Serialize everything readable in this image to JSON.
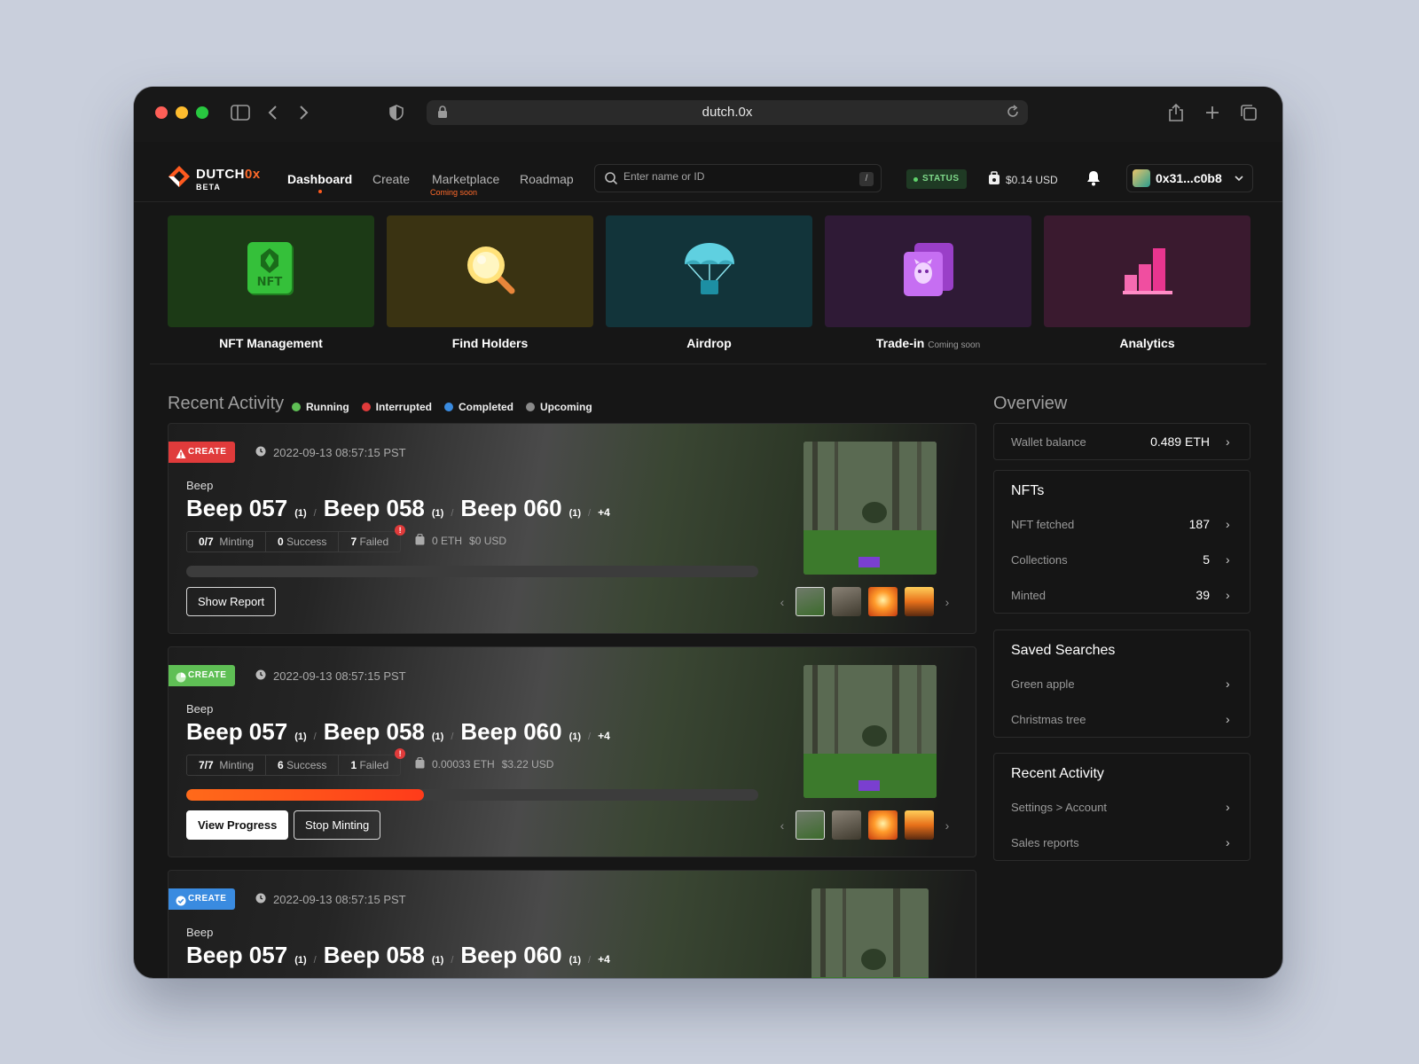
{
  "browser": {
    "url": "dutch.0x"
  },
  "logo": {
    "text": "DUTCH",
    "accent": "0x",
    "sub": "BETA"
  },
  "nav": [
    {
      "label": "Dashboard",
      "active": true
    },
    {
      "label": "Create"
    },
    {
      "label": "Marketplace",
      "note": "Coming soon"
    },
    {
      "label": "Roadmap"
    }
  ],
  "search": {
    "placeholder": "Enter name or ID",
    "shortcut": "/"
  },
  "status": "STATUS",
  "balance": "$0.14 USD",
  "account": "0x31...c0b8",
  "tiles": [
    {
      "label": "NFT Management",
      "color": "#1c3a16",
      "icon": "nft-icon"
    },
    {
      "label": "Find Holders",
      "color": "#3a3312",
      "icon": "magnifier-icon"
    },
    {
      "label": "Airdrop",
      "color": "#12343a",
      "icon": "parachute-icon"
    },
    {
      "label": "Trade-in",
      "note": "Coming soon",
      "color": "#2f1a36",
      "icon": "trade-card-icon"
    },
    {
      "label": "Analytics",
      "color": "#3a1a2f",
      "icon": "bar-chart-icon"
    }
  ],
  "recent": {
    "title": "Recent Activity",
    "legend": [
      {
        "label": "Running",
        "color": "#5fbf55"
      },
      {
        "label": "Interrupted",
        "color": "#e03b3b"
      },
      {
        "label": "Completed",
        "color": "#3a8be0"
      },
      {
        "label": "Upcoming",
        "color": "#8a8a8a"
      }
    ]
  },
  "cards": [
    {
      "badge": "CREATE",
      "badge_color": "red",
      "time": "2022-09-13 08:57:15 PST",
      "collection": "Beep",
      "items": [
        {
          "name": "Beep 057",
          "qty": "(1)"
        },
        {
          "name": "Beep 058",
          "qty": "(1)"
        },
        {
          "name": "Beep 060",
          "qty": "(1)"
        }
      ],
      "more": "+4",
      "minting": "0/7",
      "minting_label": "Minting",
      "success": "0",
      "success_label": "Success",
      "failed": "7",
      "failed_label": "Failed",
      "eth": "0 ETH",
      "usd": "$0 USD",
      "progress": 0,
      "buttons": [
        "Show Report"
      ]
    },
    {
      "badge": "CREATE",
      "badge_color": "green",
      "time": "2022-09-13 08:57:15 PST",
      "collection": "Beep",
      "items": [
        {
          "name": "Beep 057",
          "qty": "(1)"
        },
        {
          "name": "Beep 058",
          "qty": "(1)"
        },
        {
          "name": "Beep 060",
          "qty": "(1)"
        }
      ],
      "more": "+4",
      "minting": "7/7",
      "minting_label": "Minting",
      "success": "6",
      "success_label": "Success",
      "failed": "1",
      "failed_label": "Failed",
      "eth": "0.00033 ETH",
      "usd": "$3.22 USD",
      "progress": 0.415,
      "buttons": [
        "View Progress",
        "Stop Minting"
      ]
    },
    {
      "badge": "CREATE",
      "badge_color": "blue",
      "time": "2022-09-13 08:57:15 PST",
      "collection": "Beep",
      "items": [
        {
          "name": "Beep 057",
          "qty": "(1)"
        },
        {
          "name": "Beep 058",
          "qty": "(1)"
        },
        {
          "name": "Beep 060",
          "qty": "(1)"
        }
      ],
      "more": "+4"
    }
  ],
  "overview": {
    "title": "Overview",
    "wallet": {
      "label": "Wallet balance",
      "value": "0.489 ETH"
    },
    "nfts": {
      "title": "NFTs",
      "rows": [
        {
          "label": "NFT fetched",
          "value": "187"
        },
        {
          "label": "Collections",
          "value": "5"
        },
        {
          "label": "Minted",
          "value": "39"
        }
      ]
    },
    "saved": {
      "title": "Saved Searches",
      "rows": [
        {
          "label": "Green apple"
        },
        {
          "label": "Christmas tree"
        }
      ]
    },
    "recent": {
      "title": "Recent Activity",
      "rows": [
        {
          "label": "Settings > Account"
        },
        {
          "label": "Sales reports"
        }
      ]
    }
  }
}
